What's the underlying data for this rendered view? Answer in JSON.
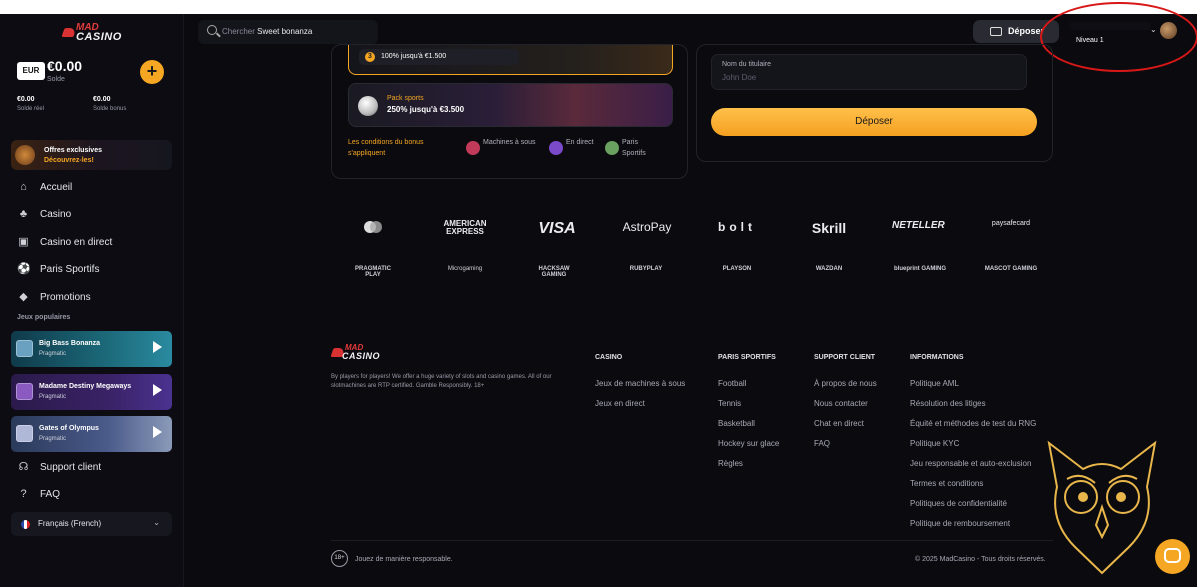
{
  "brand": {
    "logo_top": "MAD",
    "logo_bottom": "CASINO"
  },
  "wallet": {
    "currency": "EUR",
    "balance": "€0.00",
    "balance_label": "Solde",
    "real_value": "€0.00",
    "real_label": "Solde réel",
    "bonus_value": "€0.00",
    "bonus_label": "Solde bonus",
    "add_label": "+"
  },
  "offer": {
    "title": "Offres exclusives",
    "subtitle": "Découvrez-les!"
  },
  "nav": [
    {
      "label": "Accueil",
      "icon": "home-icon"
    },
    {
      "label": "Casino",
      "icon": "casino-icon"
    },
    {
      "label": "Casino en direct",
      "icon": "live-casino-icon"
    },
    {
      "label": "Paris Sportifs",
      "icon": "football-icon"
    },
    {
      "label": "Promotions",
      "icon": "diamond-icon"
    }
  ],
  "popular_heading": "Jeux populaires",
  "games": [
    {
      "title": "Big Bass Bonanza",
      "provider": "Pragmatic"
    },
    {
      "title": "Madame Destiny Megaways",
      "provider": "Pragmatic"
    },
    {
      "title": "Gates of Olympus",
      "provider": "Pragmatic"
    }
  ],
  "support_links": [
    {
      "label": "Support client",
      "icon": "headset-icon"
    },
    {
      "label": "FAQ",
      "icon": "help-icon"
    }
  ],
  "language": {
    "label": "Français (French)"
  },
  "search": {
    "prefix": "Chercher",
    "value": "Sweet bonanza"
  },
  "header": {
    "deposit_label": "Déposer",
    "user_level": "Niveau 1"
  },
  "bonus": {
    "casino_number": "3",
    "casino_text": "100% jusqu'à €1.500",
    "sports_title": "Pack sports",
    "sports_text": "250% jusqu'à €3.500",
    "conditions": "Les conditions du bonus s'appliquent",
    "tags": [
      {
        "label": "Machines à sous",
        "color": "#c23a5a"
      },
      {
        "label": "En direct",
        "color": "#7a4ac8"
      },
      {
        "label": "Paris Sportifs",
        "color": "#6aa060"
      }
    ]
  },
  "payment_form": {
    "holder_label": "Nom du titulaire",
    "holder_placeholder": "John Doe",
    "submit_label": "Déposer"
  },
  "payment_methods": [
    "mastercard",
    "AMERICAN EXPRESS",
    "VISA",
    "AstroPay",
    "bolt",
    "Skrill",
    "NETELLER",
    "paysafecard"
  ],
  "providers": [
    "PRAGMATIC PLAY",
    "Microgaming",
    "HACKSAW GAMING",
    "RUBYPLAY",
    "PLAYSON",
    "WAZDAN",
    "blueprint GAMING",
    "MASCOT GAMING"
  ],
  "footer": {
    "description": "By players for players! We offer a huge variety of slots and casino games. All of our slotmachines are RTP certified. Gamble Responsibly. 18+",
    "columns": [
      {
        "heading": "CASINO",
        "links": [
          "Jeux de machines à sous",
          "Jeux en direct"
        ]
      },
      {
        "heading": "PARIS SPORTIFS",
        "links": [
          "Football",
          "Tennis",
          "Basketball",
          "Hockey sur glace",
          "Règles"
        ]
      },
      {
        "heading": "SUPPORT CLIENT",
        "links": [
          "À propos de nous",
          "Nous contacter",
          "Chat en direct",
          "FAQ"
        ]
      },
      {
        "heading": "INFORMATIONS",
        "links": [
          "Politique AML",
          "Résolution des litiges",
          "Équité et méthodes de test du RNG",
          "Politique KYC",
          "Jeu responsable et auto-exclusion",
          "Termes et conditions",
          "Politiques de confidentialité",
          "Politique de remboursement"
        ]
      }
    ],
    "age_badge": "18+",
    "responsible": "Jouez de manière responsable.",
    "copyright": "© 2025 MadCasino - Tous droits réservés."
  },
  "colors": {
    "accent": "#f5a623",
    "highlight_ring": "#d81818"
  }
}
